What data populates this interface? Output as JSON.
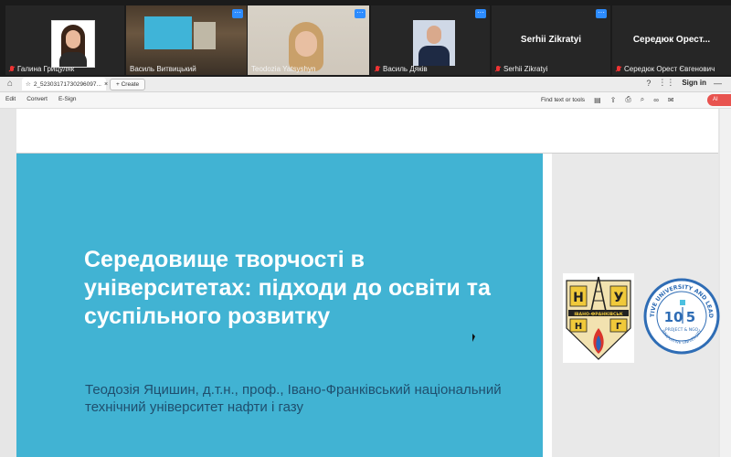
{
  "video": {
    "participants": [
      {
        "name": "Галина Грицуляк",
        "muted": true
      },
      {
        "name": "Василь Витвицький",
        "muted": false
      },
      {
        "name": "Teodozia Yatsyshyn",
        "muted": false,
        "active": true
      },
      {
        "name": "Василь Дяків",
        "muted": true
      },
      {
        "name": "Serhii Zikratyi",
        "label": "Serhii Zikratyi",
        "muted": true
      },
      {
        "name": "Середюк Орест Євгенович",
        "label": "Середюк Орест...",
        "muted": true
      }
    ],
    "more_label": "···"
  },
  "browser": {
    "tab_title": "2_52303171730296097...",
    "tab_close": "×",
    "create_label": "+ Create",
    "signin_label": "Sign in"
  },
  "toolbar": {
    "menu": [
      "Edit",
      "Convert",
      "E-Sign"
    ],
    "find_label": "Find text or tools",
    "ai_label": "AI"
  },
  "slide": {
    "title": "Середовище творчості в університетах: підходи до освіти та суспільного розвитку",
    "author": "Теодозія Яцишин, д.т.н., проф., Івано-Франківський національний технічний університет нафти і газу",
    "logo1_text_top": "НУ",
    "logo1_text_bottom": "ІВАНО-ФРАНКІВСЬК",
    "logo1_letters_bottom": "НГ",
    "logo2_ring_top": "INNOVATIVE UNIVERSITY AND LEADERSHIP",
    "logo2_center_left": "10",
    "logo2_center_right": "5",
    "logo2_caption": "PROJECT & NGO",
    "logo2_ring_bottom": "INNOVATIVE UNIVERSITY"
  },
  "colors": {
    "slide_blue": "#41b3d3",
    "author_text": "#1f4f6e",
    "active_tile_border": "#23d160",
    "ai_button": "#e8534f"
  }
}
